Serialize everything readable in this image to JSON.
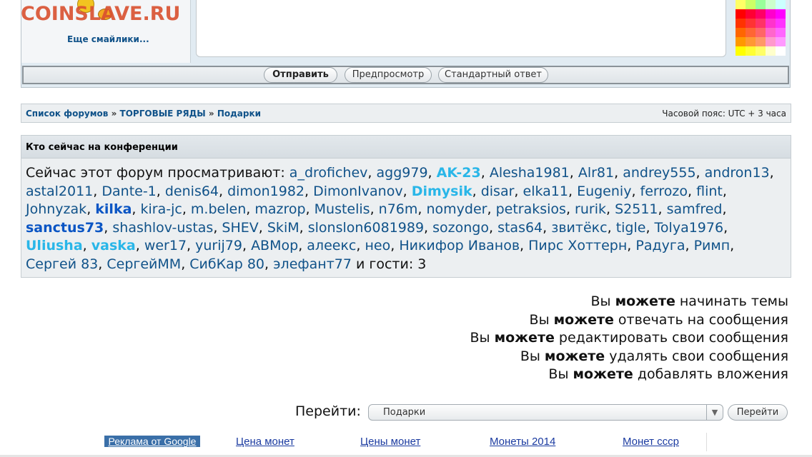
{
  "site": {
    "logo_text": "COINSLAVE.RU"
  },
  "smilies": {
    "more_label": "Еще смайлики..."
  },
  "palette": {
    "colors": [
      "#ffff66",
      "#ccff66",
      "#99ff99",
      "#ccffcc",
      "#ccffff",
      "#ff0000",
      "#ff0033",
      "#ff0066",
      "#ff00cc",
      "#ff00ff",
      "#ff3300",
      "#ff3333",
      "#ff3366",
      "#ff33cc",
      "#ff33ff",
      "#ff6600",
      "#ff6633",
      "#ff6666",
      "#ff66cc",
      "#ff66ff",
      "#ff9900",
      "#ff9933",
      "#ff9966",
      "#ff99cc",
      "#ff99ff",
      "#ffff00",
      "#ffff33",
      "#ffff66",
      "#ffffcc",
      "#ffffff"
    ]
  },
  "submit_bar": {
    "submit_label": "Отправить",
    "preview_label": "Предпросмотр",
    "default_label": "Стандартный ответ"
  },
  "breadcrumb": {
    "items": [
      "Список форумов",
      "ТОРГОВЫЕ РЯДЫ",
      "Подарки"
    ],
    "separator": "»"
  },
  "timezone": "Часовой пояс: UTC + 3 часа",
  "online": {
    "heading": "Кто сейчас на конференции",
    "intro": "Сейчас этот форум просматривают: ",
    "users": [
      {
        "name": "a_drofichev",
        "style": "normal"
      },
      {
        "name": "agg979",
        "style": "normal"
      },
      {
        "name": "AK-23",
        "style": "hl"
      },
      {
        "name": "Alesha1981",
        "style": "normal"
      },
      {
        "name": "Alr81",
        "style": "normal"
      },
      {
        "name": "andrey555",
        "style": "normal"
      },
      {
        "name": "andron13",
        "style": "normal"
      },
      {
        "name": "astal2011",
        "style": "normal"
      },
      {
        "name": "Dante-1",
        "style": "normal"
      },
      {
        "name": "denis64",
        "style": "normal"
      },
      {
        "name": "dimon1982",
        "style": "normal"
      },
      {
        "name": "DimonIvanov",
        "style": "normal"
      },
      {
        "name": "Dimysik",
        "style": "hl"
      },
      {
        "name": "disar",
        "style": "normal"
      },
      {
        "name": "elka11",
        "style": "normal"
      },
      {
        "name": "Eugeniy",
        "style": "normal"
      },
      {
        "name": "ferrozo",
        "style": "normal"
      },
      {
        "name": "flint",
        "style": "normal"
      },
      {
        "name": "Johnyzak",
        "style": "normal"
      },
      {
        "name": "kilka",
        "style": "mod"
      },
      {
        "name": "kira-jc",
        "style": "normal"
      },
      {
        "name": "m.belen",
        "style": "normal"
      },
      {
        "name": "mazrop",
        "style": "normal"
      },
      {
        "name": "Mustelis",
        "style": "normal"
      },
      {
        "name": "n76m",
        "style": "normal"
      },
      {
        "name": "nomyder",
        "style": "normal"
      },
      {
        "name": "petraksios",
        "style": "normal"
      },
      {
        "name": "rurik",
        "style": "normal"
      },
      {
        "name": "S2511",
        "style": "normal"
      },
      {
        "name": "samfred",
        "style": "normal"
      },
      {
        "name": "sanctus73",
        "style": "mod"
      },
      {
        "name": "shashlov-ustas",
        "style": "normal"
      },
      {
        "name": "SHEV",
        "style": "normal"
      },
      {
        "name": "SkiM",
        "style": "normal"
      },
      {
        "name": "slonslon6081989",
        "style": "normal"
      },
      {
        "name": "sozongo",
        "style": "normal"
      },
      {
        "name": "stas64",
        "style": "normal"
      },
      {
        "name": "звитёкс",
        "style": "normal"
      },
      {
        "name": "tigle",
        "style": "normal"
      },
      {
        "name": "Tolya1976",
        "style": "normal"
      },
      {
        "name": "Uliusha",
        "style": "hl"
      },
      {
        "name": "vaska",
        "style": "hl"
      },
      {
        "name": "wer17",
        "style": "normal"
      },
      {
        "name": "yurij79",
        "style": "normal"
      },
      {
        "name": "АВМор",
        "style": "normal"
      },
      {
        "name": "алеекс",
        "style": "normal"
      },
      {
        "name": "нео",
        "style": "normal"
      },
      {
        "name": "Никифор Иванов",
        "style": "normal"
      },
      {
        "name": "Пирс Хоттерн",
        "style": "normal"
      },
      {
        "name": "Радуга",
        "style": "normal"
      },
      {
        "name": "Римп",
        "style": "normal"
      },
      {
        "name": "Сергей 83",
        "style": "normal"
      },
      {
        "name": "СергейММ",
        "style": "normal"
      },
      {
        "name": "СибКар 80",
        "style": "normal"
      },
      {
        "name": "элефант77",
        "style": "normal"
      }
    ],
    "guests_text": " и гости: 3"
  },
  "permissions": [
    {
      "pre": "Вы ",
      "bold": "можете",
      "post": " начинать темы"
    },
    {
      "pre": "Вы ",
      "bold": "можете",
      "post": " отвечать на сообщения"
    },
    {
      "pre": "Вы ",
      "bold": "можете",
      "post": " редактировать свои сообщения"
    },
    {
      "pre": "Вы ",
      "bold": "можете",
      "post": " удалять свои сообщения"
    },
    {
      "pre": "Вы ",
      "bold": "можете",
      "post": " добавлять вложения"
    }
  ],
  "jump": {
    "label": "Перейти:",
    "selected": "Подарки",
    "go_label": "Перейти"
  },
  "ads": {
    "badge": "Реклама от Google",
    "links": [
      "Цена монет",
      "Цены монет",
      "Монеты 2014",
      "Монет ссср"
    ]
  }
}
